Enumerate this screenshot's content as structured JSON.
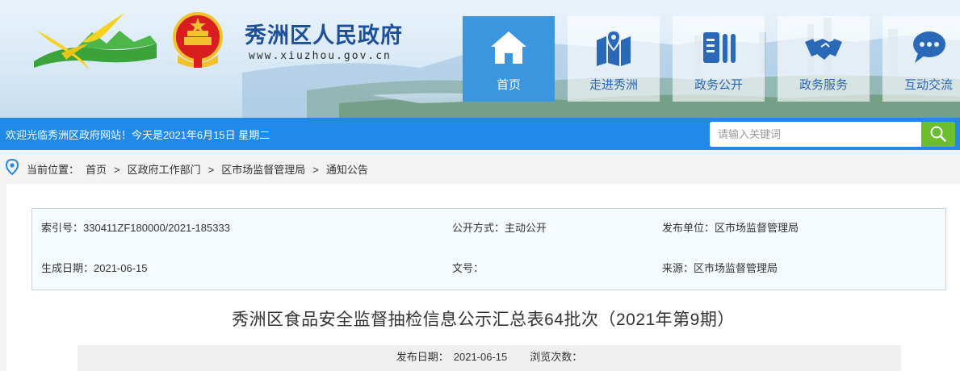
{
  "header": {
    "site_name": "秀洲区人民政府",
    "site_url": "www.xiuzhou.gov.cn",
    "nav": [
      {
        "label": "首页",
        "icon": "home-icon",
        "active": true
      },
      {
        "label": "走进秀洲",
        "icon": "map-icon",
        "active": false
      },
      {
        "label": "政务公开",
        "icon": "document-icon",
        "active": false
      },
      {
        "label": "政务服务",
        "icon": "handshake-icon",
        "active": false
      },
      {
        "label": "互动交流",
        "icon": "chat-icon",
        "active": false
      }
    ]
  },
  "welcome_bar": {
    "text": "欢迎光临秀洲区政府网站！今天是2021年6月15日 星期二",
    "search_placeholder": "请输入关键词"
  },
  "breadcrumb": {
    "label": "当前位置：",
    "items": [
      "首页",
      "区政府工作部门",
      "区市场监督管理局",
      "通知公告"
    ],
    "separator": ">"
  },
  "info": {
    "index_no": "索引号：330411ZF180000/2021-185333",
    "open_mode": "公开方式：主动公开",
    "publisher": "发布单位：区市场监督管理局",
    "created_date": "生成日期：2021-06-15",
    "doc_no": "文号：",
    "source": "来源：区市场监督管理局"
  },
  "article": {
    "title": "秀洲区食品安全监督抽检信息公示汇总表64批次（2021年第9期）",
    "publish_label": "发布日期：",
    "publish_date": "2021-06-15",
    "views_label": "浏览次数："
  },
  "colors": {
    "brand_blue": "#2189e8",
    "nav_active": "#3b96de",
    "search_green": "#6cbf2c",
    "title_blue": "#1d4f9a"
  }
}
